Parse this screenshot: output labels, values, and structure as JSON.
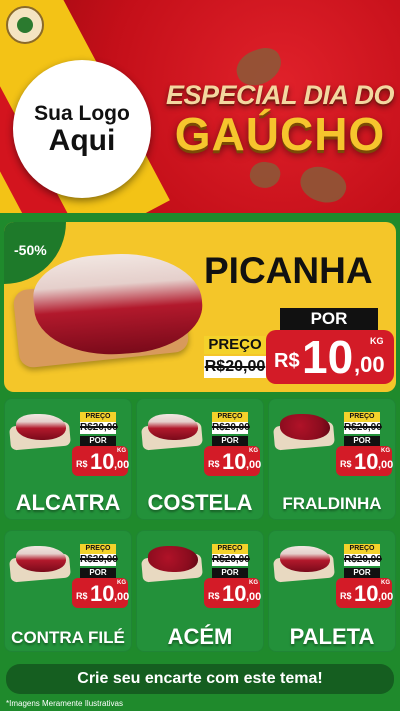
{
  "header": {
    "logo_line1": "Sua Logo",
    "logo_line2": "Aqui",
    "event_line1": "ESPECIAL DIA DO",
    "event_line2": "GAÚCHO",
    "colors": {
      "red": "#c40f19",
      "yellow": "#f3c316",
      "green": "#1e8a2c"
    }
  },
  "featured": {
    "discount": "-50%",
    "name": "PICANHA",
    "preco_label": "PREÇO",
    "old_price": "R$20,00",
    "por_label": "POR",
    "currency": "R$",
    "price_int": "10",
    "price_dec": ",00",
    "unit": "KG"
  },
  "products": [
    {
      "name": "ALCATRA",
      "preco_label": "PREÇO",
      "old_price": "R$20,00",
      "por_label": "POR",
      "currency": "R$",
      "price_int": "10",
      "price_dec": ",00",
      "unit": "KG"
    },
    {
      "name": "COSTELA",
      "preco_label": "PREÇO",
      "old_price": "R$20,00",
      "por_label": "POR",
      "currency": "R$",
      "price_int": "10",
      "price_dec": ",00",
      "unit": "KG"
    },
    {
      "name": "FRALDINHA",
      "preco_label": "PREÇO",
      "old_price": "R$20,00",
      "por_label": "POR",
      "currency": "R$",
      "price_int": "10",
      "price_dec": ",00",
      "unit": "KG"
    },
    {
      "name": "CONTRA FILÉ",
      "preco_label": "PREÇO",
      "old_price": "R$20,00",
      "por_label": "POR",
      "currency": "R$",
      "price_int": "10",
      "price_dec": ",00",
      "unit": "KG"
    },
    {
      "name": "ACÉM",
      "preco_label": "PREÇO",
      "old_price": "R$20,00",
      "por_label": "POR",
      "currency": "R$",
      "price_int": "10",
      "price_dec": ",00",
      "unit": "KG"
    },
    {
      "name": "PALETA",
      "preco_label": "PREÇO",
      "old_price": "R$20,00",
      "por_label": "POR",
      "currency": "R$",
      "price_int": "10",
      "price_dec": ",00",
      "unit": "KG"
    }
  ],
  "cta": "Crie seu encarte com este tema!",
  "disclaimer": "*Imagens Meramente Ilustrativas"
}
